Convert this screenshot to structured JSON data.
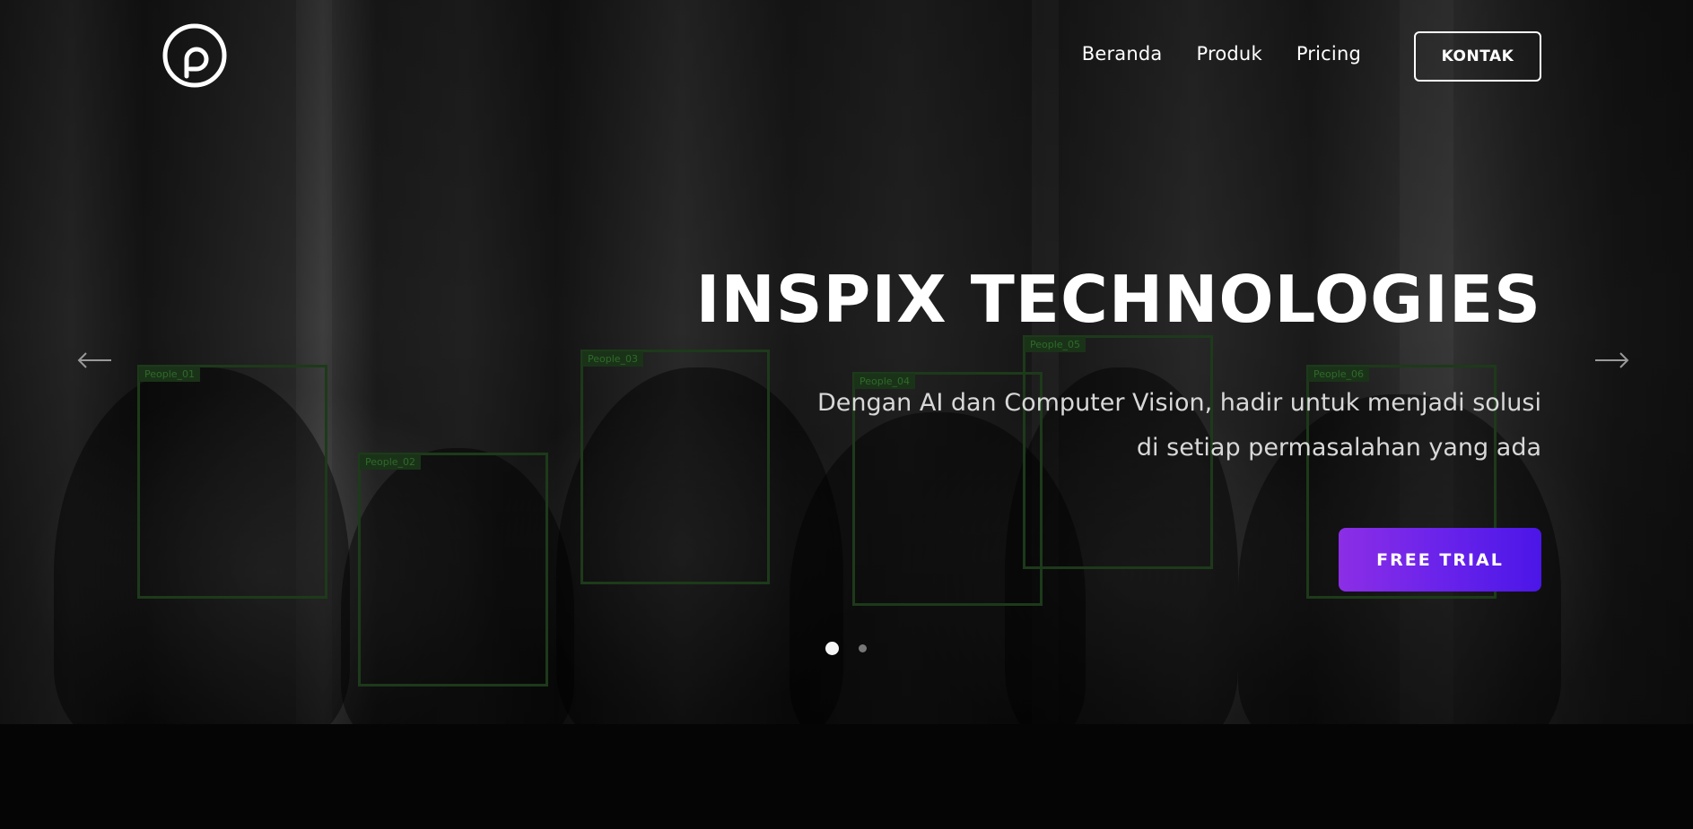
{
  "header": {
    "logo_name": "inspix-logo-icon",
    "nav": [
      {
        "label": "Beranda"
      },
      {
        "label": "Produk"
      },
      {
        "label": "Pricing"
      }
    ],
    "contact_button": "KONTAK"
  },
  "hero": {
    "title": "INSPIX TECHNOLOGIES",
    "subtitle_line1": "Dengan AI dan Computer Vision, hadir untuk menjadi solusi",
    "subtitle_line2": "di setiap permasalahan yang ada",
    "cta": "FREE TRIAL",
    "detections": [
      {
        "label": "People_01"
      },
      {
        "label": "People_02"
      },
      {
        "label": "People_03"
      },
      {
        "label": "People_04"
      },
      {
        "label": "People_05"
      },
      {
        "label": "People_06"
      }
    ]
  },
  "carousel": {
    "prev_icon": "arrow-left-icon",
    "next_icon": "arrow-right-icon",
    "slide_count": 2,
    "active_slide": 1
  },
  "colors": {
    "accent_gradient_start": "#8c2ee6",
    "accent_gradient_end": "#4b16e8",
    "detection_box": "#1d3a1a",
    "background": "#050505"
  }
}
